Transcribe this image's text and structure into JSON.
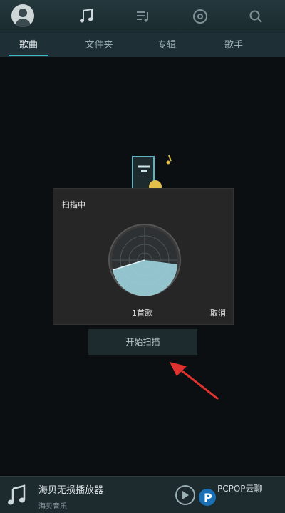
{
  "top_nav": {
    "icons": [
      "avatar-icon",
      "music-note-icon",
      "playlist-icon",
      "disc-icon",
      "search-icon"
    ]
  },
  "tabs": [
    {
      "label": "歌曲",
      "active": true
    },
    {
      "label": "文件夹",
      "active": false
    },
    {
      "label": "专辑",
      "active": false
    },
    {
      "label": "歌手",
      "active": false
    }
  ],
  "dialog": {
    "title": "扫描中",
    "count": "1首歌",
    "cancel": "取消"
  },
  "start_button": "开始扫描",
  "player": {
    "title": "海贝无损播放器",
    "subtitle": "海贝音乐"
  },
  "watermark": "PCPOP云聊",
  "colors": {
    "accent": "#3fb6c4",
    "arrow": "#e0322f",
    "radar": "#9fd4dd"
  }
}
